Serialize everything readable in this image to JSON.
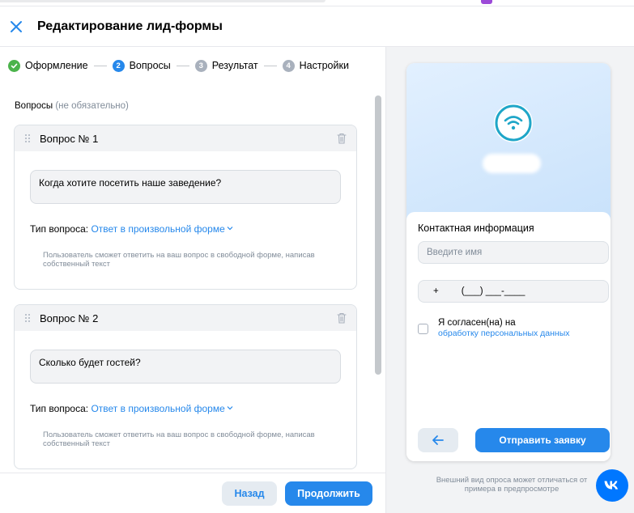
{
  "header": {
    "title": "Редактирование лид-формы"
  },
  "steps": [
    {
      "num": "✓",
      "label": "Оформление",
      "state": "done"
    },
    {
      "num": "2",
      "label": "Вопросы",
      "state": "active"
    },
    {
      "num": "3",
      "label": "Результат",
      "state": "todo"
    },
    {
      "num": "4",
      "label": "Настройки",
      "state": "todo"
    }
  ],
  "questions_section": {
    "title": "Вопросы",
    "optional": "(не обязательно)"
  },
  "questions": [
    {
      "title": "Вопрос № 1",
      "text": "Когда хотите посетить наше заведение?",
      "type_label": "Тип вопроса:",
      "type_value": "Ответ в произвольной форме",
      "hint": "Пользователь сможет ответить на ваш вопрос в свободной форме, написав собственный текст"
    },
    {
      "title": "Вопрос № 2",
      "text": "Сколько будет гостей?",
      "type_label": "Тип вопроса:",
      "type_value": "Ответ в произвольной форме",
      "hint": "Пользователь сможет ответить на ваш вопрос в свободной форме, написав собственный текст"
    }
  ],
  "footer": {
    "back_label": "Назад",
    "next_label": "Продолжить"
  },
  "preview": {
    "contact_title": "Контактная информация",
    "name_placeholder": "Введите имя",
    "phone_plus": "+",
    "phone_mask": "(___) ___-____",
    "consent_text": "Я согласен(на) на",
    "consent_link": "обработку персональных данных",
    "submit_label": "Отправить заявку",
    "note": "Внешний вид опроса может отличаться от примера в предпросмотре"
  },
  "icons": {
    "close": "close-icon",
    "drag": "drag-handle-icon",
    "trash": "trash-icon",
    "chevron": "chevron-down-icon",
    "wifi": "wifi-icon",
    "arrow_left": "arrow-left-icon",
    "vk": "vk-logo-icon"
  },
  "colors": {
    "accent": "#2688eb",
    "success": "#4bb34b",
    "muted": "#818c99",
    "vk_blue": "#0077ff",
    "wifi_teal": "#1fa6c8"
  }
}
